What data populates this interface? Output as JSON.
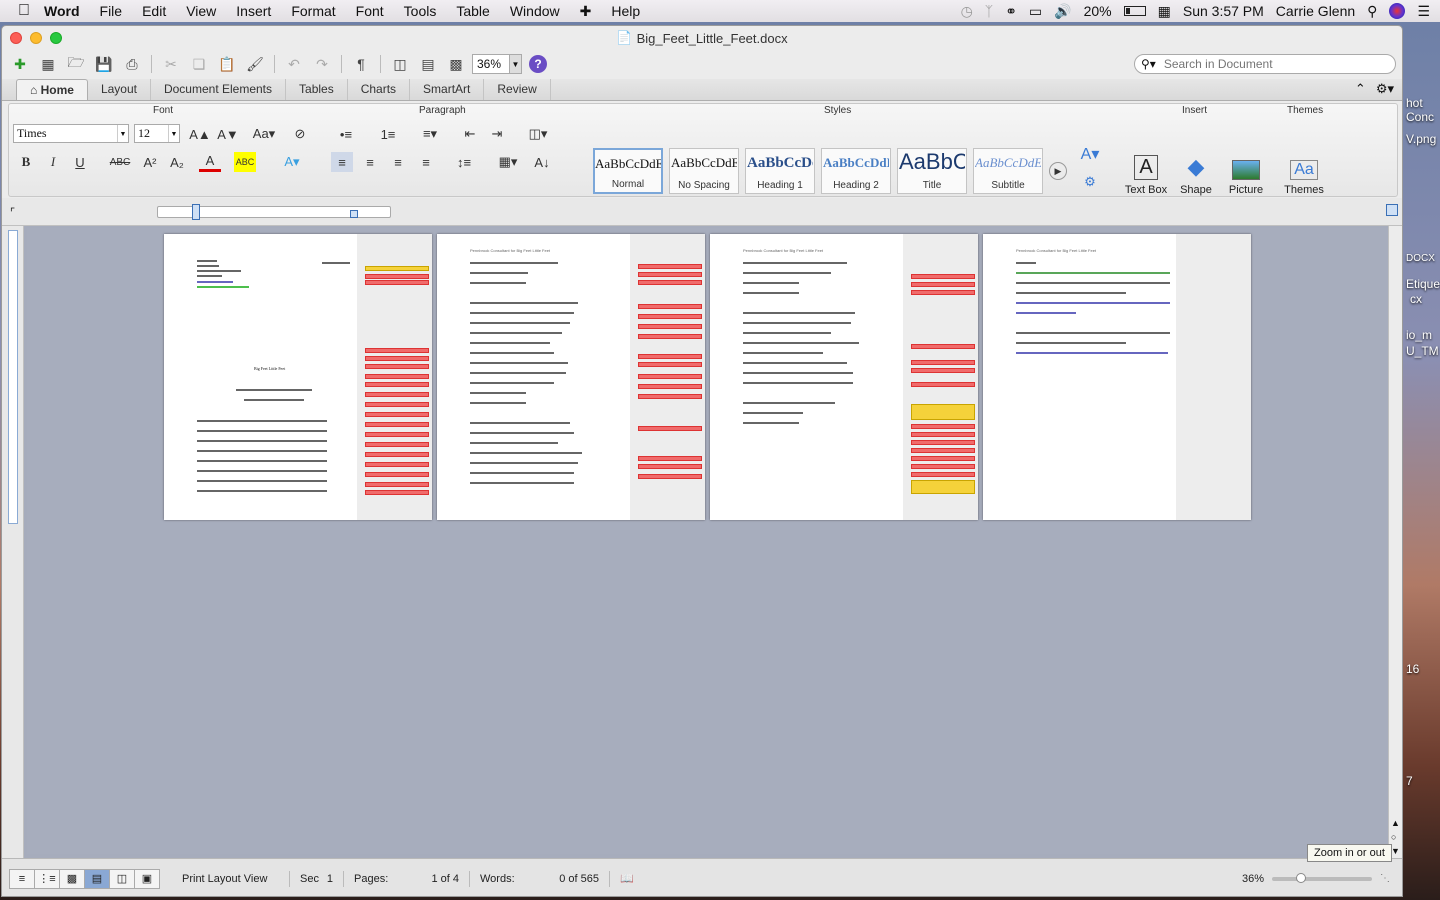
{
  "menubar": {
    "app": "Word",
    "items": [
      "File",
      "Edit",
      "View",
      "Insert",
      "Format",
      "Font",
      "Tools",
      "Table",
      "Window",
      "Help"
    ],
    "battery": "20%",
    "clock": "Sun 3:57 PM",
    "user": "Carrie Glenn"
  },
  "window": {
    "title": "Big_Feet_Little_Feet.docx"
  },
  "toolbar": {
    "zoom": "36%"
  },
  "search": {
    "placeholder": "Search in Document"
  },
  "tabs": [
    "Home",
    "Layout",
    "Document Elements",
    "Tables",
    "Charts",
    "SmartArt",
    "Review"
  ],
  "ribbon": {
    "groups": {
      "font": "Font",
      "paragraph": "Paragraph",
      "styles": "Styles",
      "insert": "Insert",
      "themes": "Themes"
    },
    "font_name": "Times",
    "font_size": "12",
    "styles": [
      {
        "preview": "AaBbCcDdEe",
        "name": "Normal"
      },
      {
        "preview": "AaBbCcDdEe",
        "name": "No Spacing"
      },
      {
        "preview": "AaBbCcDc",
        "name": "Heading 1"
      },
      {
        "preview": "AaBbCcDdEe",
        "name": "Heading 2"
      },
      {
        "preview": "AaBbC",
        "name": "Title"
      },
      {
        "preview": "AaBbCcDdE",
        "name": "Subtitle"
      }
    ],
    "insert_buttons": [
      "Text Box",
      "Shape",
      "Picture"
    ],
    "themes_label": "Themes"
  },
  "document": {
    "page_header": "Pennbrook Consultant for Big Feet Little Feet",
    "doc_title": "Big Feet Little Feet"
  },
  "status": {
    "view": "Print Layout View",
    "sec_label": "Sec",
    "sec_value": "1",
    "pages_label": "Pages:",
    "pages_value": "1 of 4",
    "words_label": "Words:",
    "words_value": "0 of 565",
    "zoom": "36%"
  },
  "tooltip": "Zoom in or out",
  "desktop_labels": [
    "hot",
    "Conc",
    "V.png",
    "DOCX",
    "Etiquet",
    "cx",
    "io_m",
    "U_TM",
    "16",
    "7"
  ]
}
